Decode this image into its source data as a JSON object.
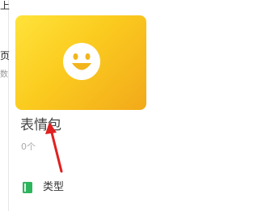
{
  "left_strip": {
    "glyphs": [
      "上",
      "页",
      "数"
    ]
  },
  "card": {
    "icon": "smiley-face-icon",
    "title": "表情包",
    "count": "0个"
  },
  "type_row": {
    "icon": "green-book-icon",
    "label": "类型"
  },
  "annotation": {
    "icon": "red-arrow-icon",
    "color": "#e02020"
  },
  "colors": {
    "card_gradient_start": "#ffe33a",
    "card_gradient_end": "#f2a91a",
    "type_icon": "#2db55d"
  }
}
